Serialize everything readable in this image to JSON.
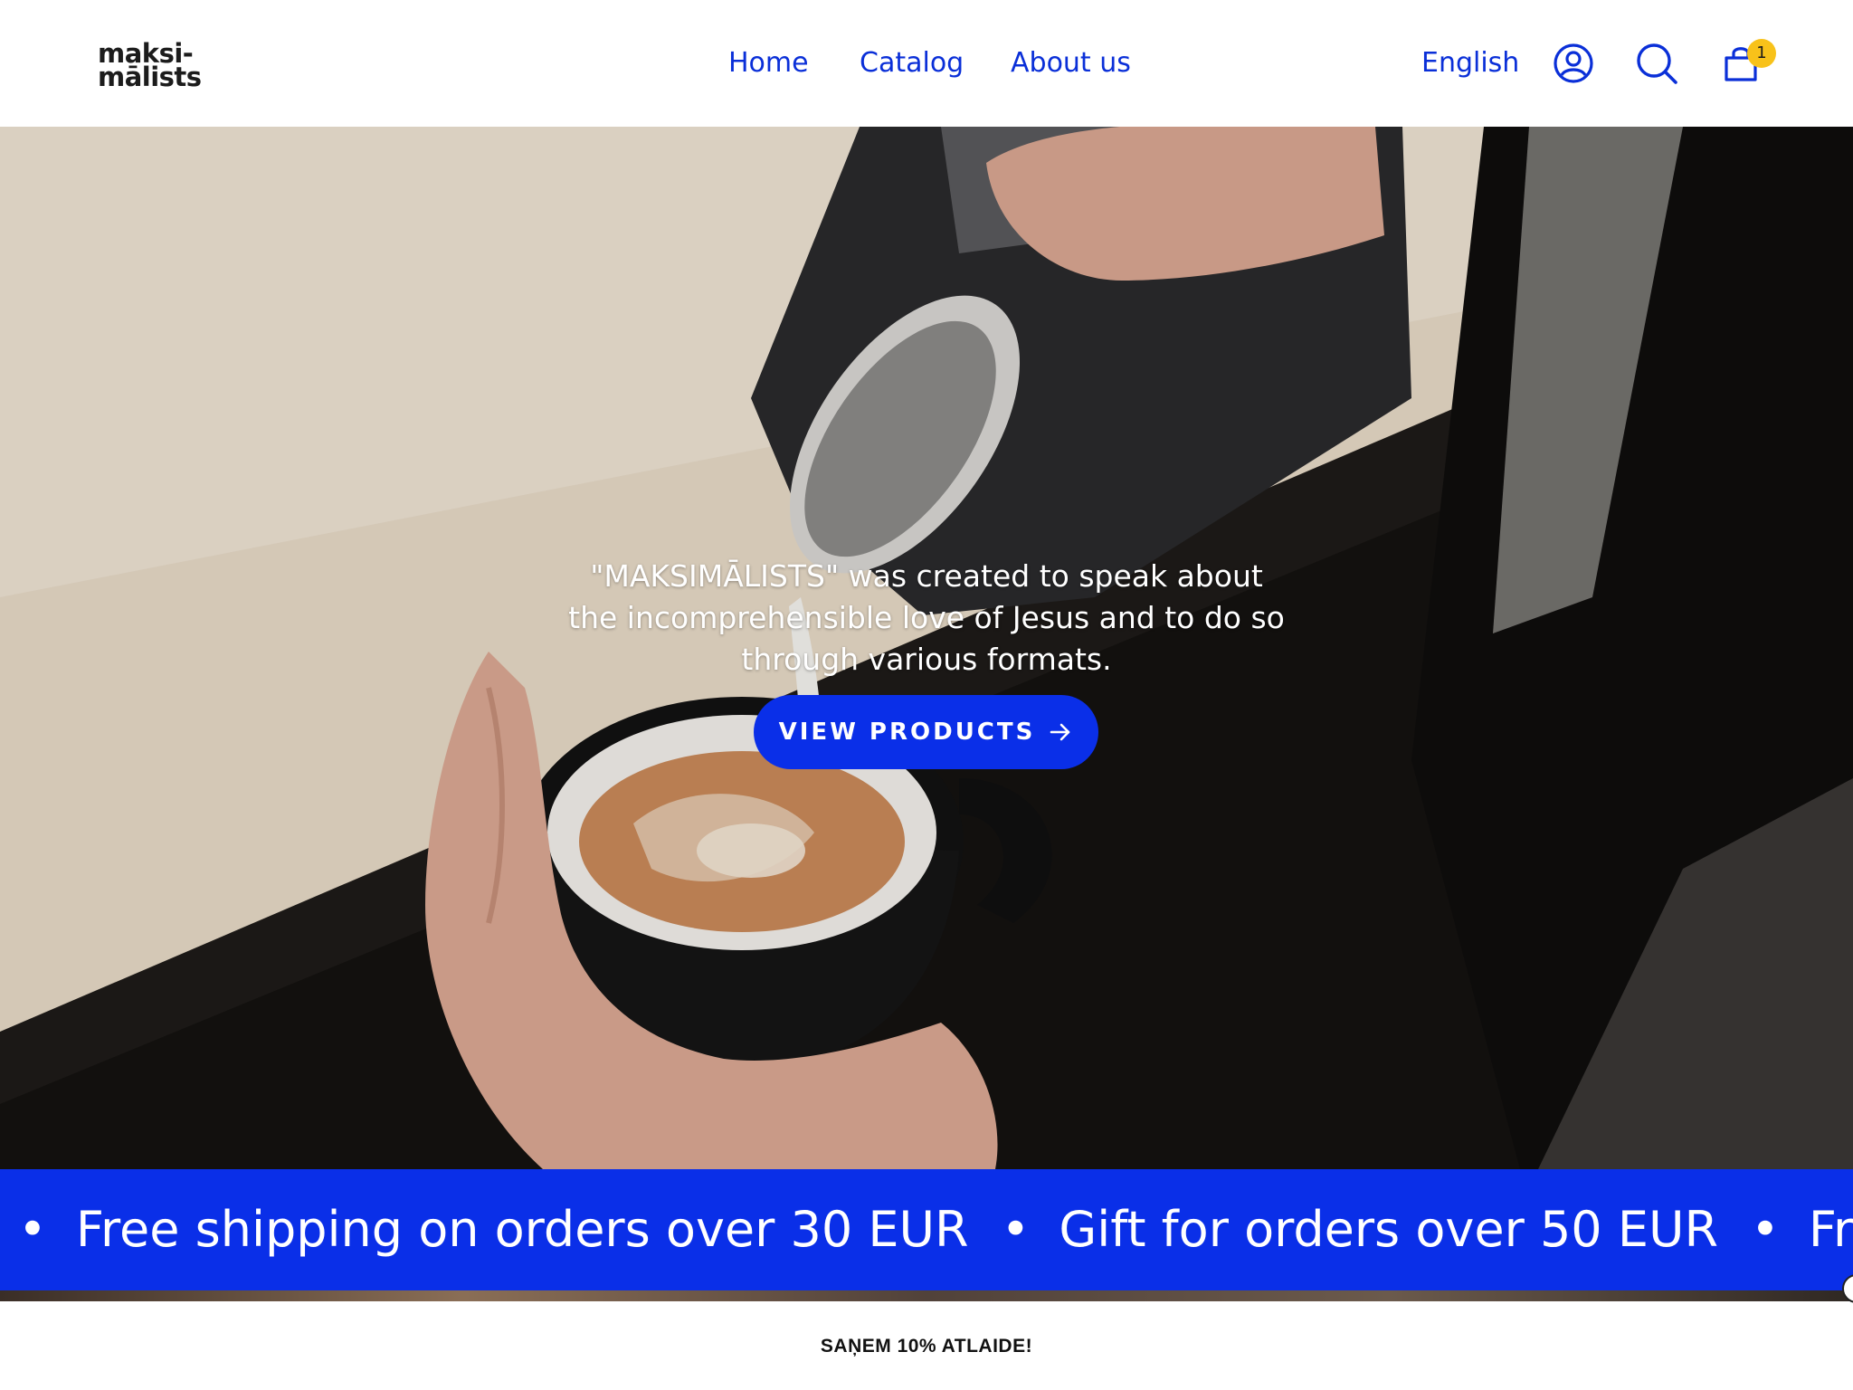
{
  "header": {
    "logo_line1": "maksi-",
    "logo_line2": "mālists",
    "nav": {
      "home": "Home",
      "catalog": "Catalog",
      "about": "About us"
    },
    "language": "English",
    "cart_count": "1",
    "icons": [
      "account-icon",
      "search-icon",
      "cart-icon"
    ]
  },
  "hero": {
    "text": "\"MAKSIMĀLISTS\" was created to speak about the incomprehensible love of Jesus and to do so through various formats.",
    "cta_label": "VIEW PRODUCTS"
  },
  "marquee": {
    "bullet": "•",
    "items": [
      "Free shipping on orders over 30 EUR",
      "Gift for orders over 50 EUR",
      "Free shippi"
    ]
  },
  "promo": {
    "text": "SAŅEM 10% ATLAIDE!"
  },
  "colors": {
    "brand_blue": "#0a2fe8",
    "nav_blue": "#0a2fd8",
    "badge_yellow": "#f8c21a"
  }
}
